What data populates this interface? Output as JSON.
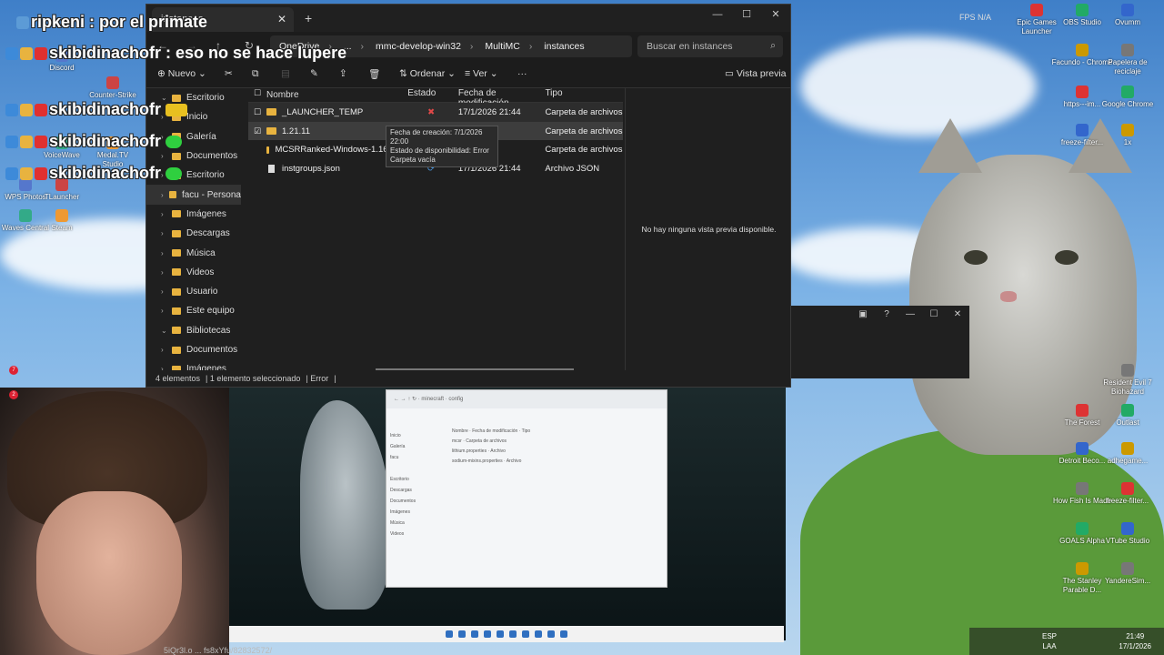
{
  "explorer": {
    "tab_title": "instances",
    "breadcrumbs": [
      "OneDrive",
      "...",
      "mmc-develop-win32",
      "MultiMC",
      "instances"
    ],
    "search_placeholder": "Buscar en instances",
    "toolbar": {
      "new_label": "Nuevo",
      "sort_label": "Ordenar",
      "view_label": "Ver",
      "preview_label": "Vista previa"
    },
    "columns": [
      "Nombre",
      "Estado",
      "Fecha de modificación",
      "Tipo"
    ],
    "rows": [
      {
        "name": "_LAUNCHER_TEMP",
        "date": "17/1/2026 21:44",
        "type": "Carpeta de archivos",
        "kind": "folder"
      },
      {
        "name": "1.21.11",
        "date": "23",
        "type": "Carpeta de archivos",
        "kind": "folder"
      },
      {
        "name": "MCSRRanked-Windows-1.16.1-All",
        "date": "44",
        "type": "Carpeta de archivos",
        "kind": "folder"
      },
      {
        "name": "instgroups.json",
        "date": "17/1/2026 21:44",
        "type": "Archivo JSON",
        "kind": "file"
      }
    ],
    "tooltip": [
      "Fecha de creación: 7/1/2026 22:00",
      "Estado de disponibilidad: Error",
      "Carpeta vacía"
    ],
    "sidebar": [
      {
        "label": "Escritorio",
        "expanded": true
      },
      {
        "label": "Inicio"
      },
      {
        "label": "Galería"
      },
      {
        "label": "Documentos"
      },
      {
        "label": "Escritorio"
      },
      {
        "label": "facu - Persona",
        "selected": true
      },
      {
        "label": "Imágenes"
      },
      {
        "label": "Descargas"
      },
      {
        "label": "Música"
      },
      {
        "label": "Videos"
      },
      {
        "label": "Usuario"
      },
      {
        "label": "Este equipo"
      },
      {
        "label": "Bibliotecas",
        "expanded": true
      },
      {
        "label": "Documentos"
      },
      {
        "label": "Imágenes"
      }
    ],
    "preview_message": "No hay ninguna vista previa disponible.",
    "status": {
      "count": "4 elementos",
      "selected": "1 elemento seleccionado",
      "error": "Error"
    }
  },
  "chat": [
    {
      "user": "ripkeni",
      "message": "por el primate"
    },
    {
      "user": "skibidinachofr",
      "message": "eso no se hace lupere"
    },
    {
      "user": "skibidinachofr",
      "message": ""
    },
    {
      "user": "skibidinachofr",
      "message": ""
    },
    {
      "user": "skibidinachofr",
      "message": ""
    }
  ],
  "desktop_icons": [
    {
      "label": "Epic Games Launcher"
    },
    {
      "label": "OBS Studio"
    },
    {
      "label": "Ovumm"
    },
    {
      "label": "Facundo - Chrome"
    },
    {
      "label": "Papelera de reciclaje"
    },
    {
      "label": "https---im..."
    },
    {
      "label": "Google Chrome"
    },
    {
      "label": "freeze-filter..."
    },
    {
      "label": "1x"
    },
    {
      "label": "Resident Evil 7 Biohazard"
    },
    {
      "label": "The Forest"
    },
    {
      "label": "Outlast"
    },
    {
      "label": "Detroit Beco..."
    },
    {
      "label": "adhegame..."
    },
    {
      "label": "How Fish Is Made"
    },
    {
      "label": "freeze-filter..."
    },
    {
      "label": "GOALS Alpha"
    },
    {
      "label": "VTube Studio"
    },
    {
      "label": "The Stanley Parable D..."
    },
    {
      "label": "YandereSim..."
    }
  ],
  "left_icons": [
    "Discord",
    "Counter-Strike",
    "VoiceWave",
    "Medal.TV Studio",
    "WPS Photos",
    "TLauncher",
    "Waves Central",
    "Steam"
  ],
  "fps_label": "FPS N/A",
  "taskbar": {
    "lang": "ESP",
    "lang2": "LAA",
    "time": "21:49",
    "date": "17/1/2026"
  },
  "bottom_url": "5iQr3l.o ... fs8xYfu/82832572/",
  "colors": {
    "folder": "#e8b33f",
    "window_bg": "#1f1f1f",
    "selection": "#3d3d3d"
  }
}
